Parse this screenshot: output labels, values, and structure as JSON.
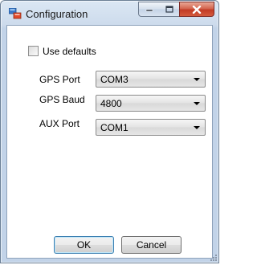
{
  "window": {
    "title": "Configuration",
    "icon": "app-window-icon",
    "controls": {
      "minimize": "minimize-icon",
      "maximize": "maximize-icon",
      "close": "close-icon"
    }
  },
  "form": {
    "use_defaults": {
      "label": "Use defaults",
      "checked": false
    },
    "fields": [
      {
        "label": "GPS Port",
        "value": "COM3"
      },
      {
        "label": "GPS Baud",
        "value": "4800"
      },
      {
        "label": "AUX Port",
        "value": "COM1"
      }
    ]
  },
  "buttons": {
    "ok": "OK",
    "cancel": "Cancel"
  },
  "colors": {
    "title_bar": "#cddbec",
    "close_button": "#c23b25",
    "default_button_border": "#3c7fb1"
  }
}
